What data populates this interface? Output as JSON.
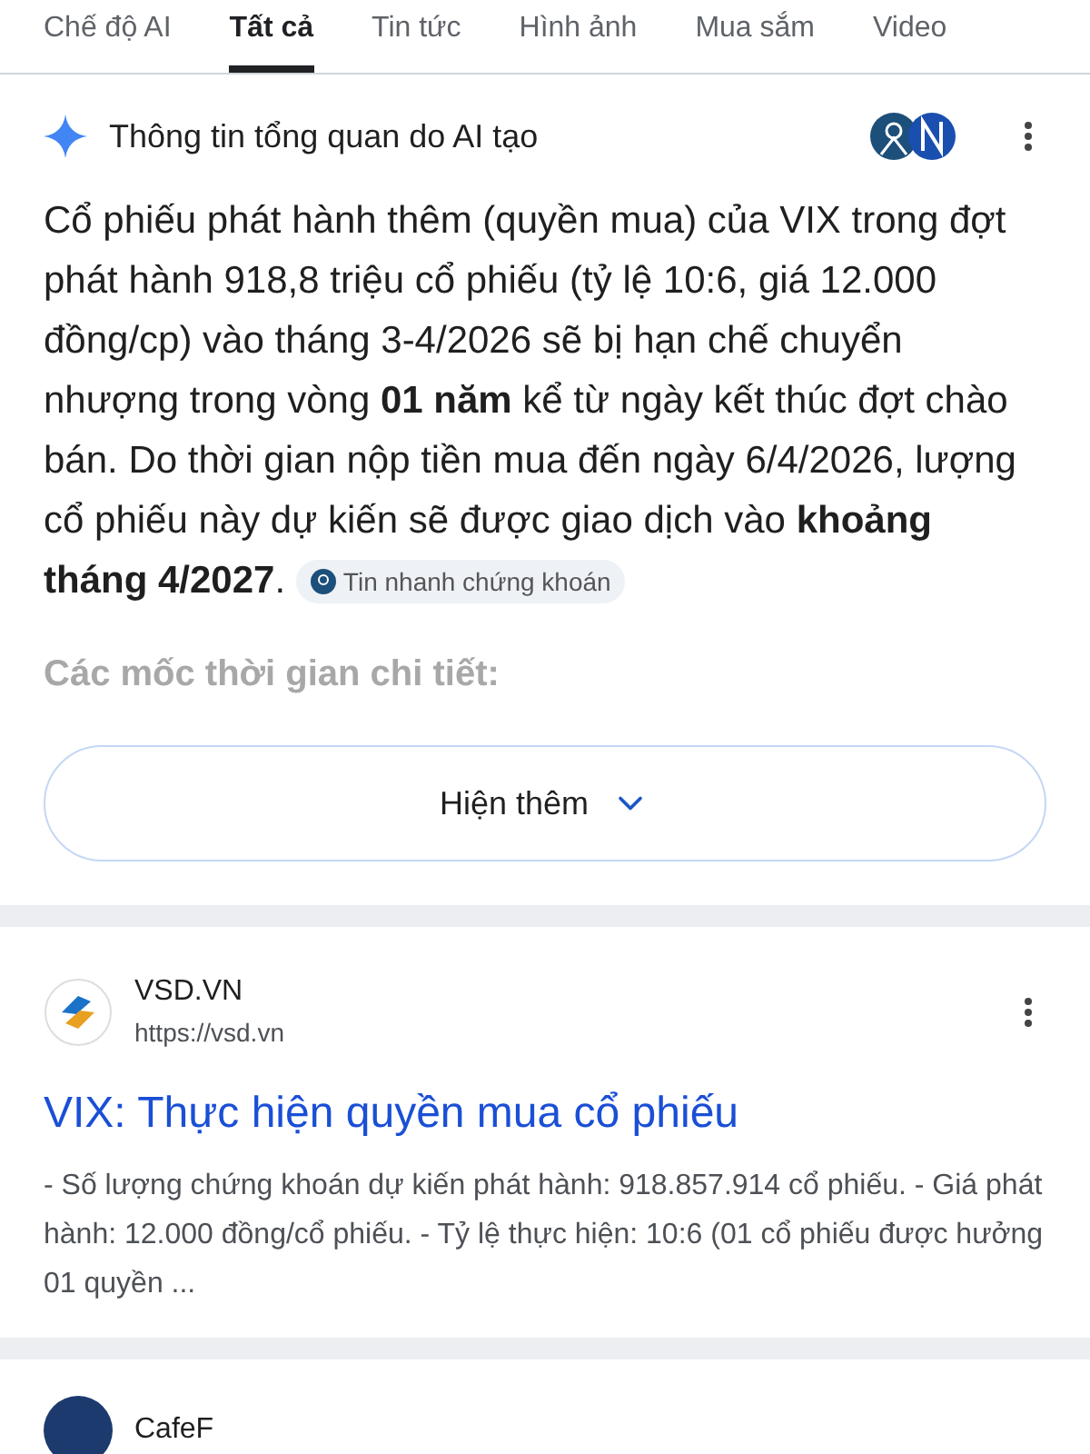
{
  "tabs": [
    {
      "label": "Chế độ AI",
      "selected": false
    },
    {
      "label": "Tất cả",
      "selected": true
    },
    {
      "label": "Tin tức",
      "selected": false
    },
    {
      "label": "Hình ảnh",
      "selected": false
    },
    {
      "label": "Mua sắm",
      "selected": false
    },
    {
      "label": "Video",
      "selected": false
    }
  ],
  "ai_overview": {
    "title": "Thông tin tổng quan do AI tạo",
    "text": "Cổ phiếu phát hành thêm (quyền mua) của VIX trong đợt phát hành 918,8 triệu cổ phiếu (tỷ lệ 10:6, giá 12.000 đồng/cp) vào tháng 3-4/2026 sẽ bị hạn chế chuyển nhượng trong vòng **01 năm** kể từ ngày kết thúc đợt chào bán. Do thời gian nộp tiền mua đến ngày 6/4/2026, lượng cổ phiếu này dự kiến sẽ được giao dịch vào **khoảng tháng 4/2027**.",
    "citation": "Tin nhanh chứng khoán",
    "faded_heading": "Các mốc thời gian chi tiết:",
    "more_button": "Hiện thêm"
  },
  "results": [
    {
      "site": "VSD.VN",
      "url": "https://vsd.vn",
      "title": "VIX: Thực hiện quyền mua cổ phiếu",
      "snippet": "- Số lượng chứng khoán dự kiến phát hành: 918.857.914 cổ phiếu. - Giá phát hành: 12.000 đồng/cổ phiếu. - Tỷ lệ thực hiện: 10:6 (01 cổ phiếu được hưởng 01 quyền ..."
    },
    {
      "site": "CafeF"
    }
  ]
}
